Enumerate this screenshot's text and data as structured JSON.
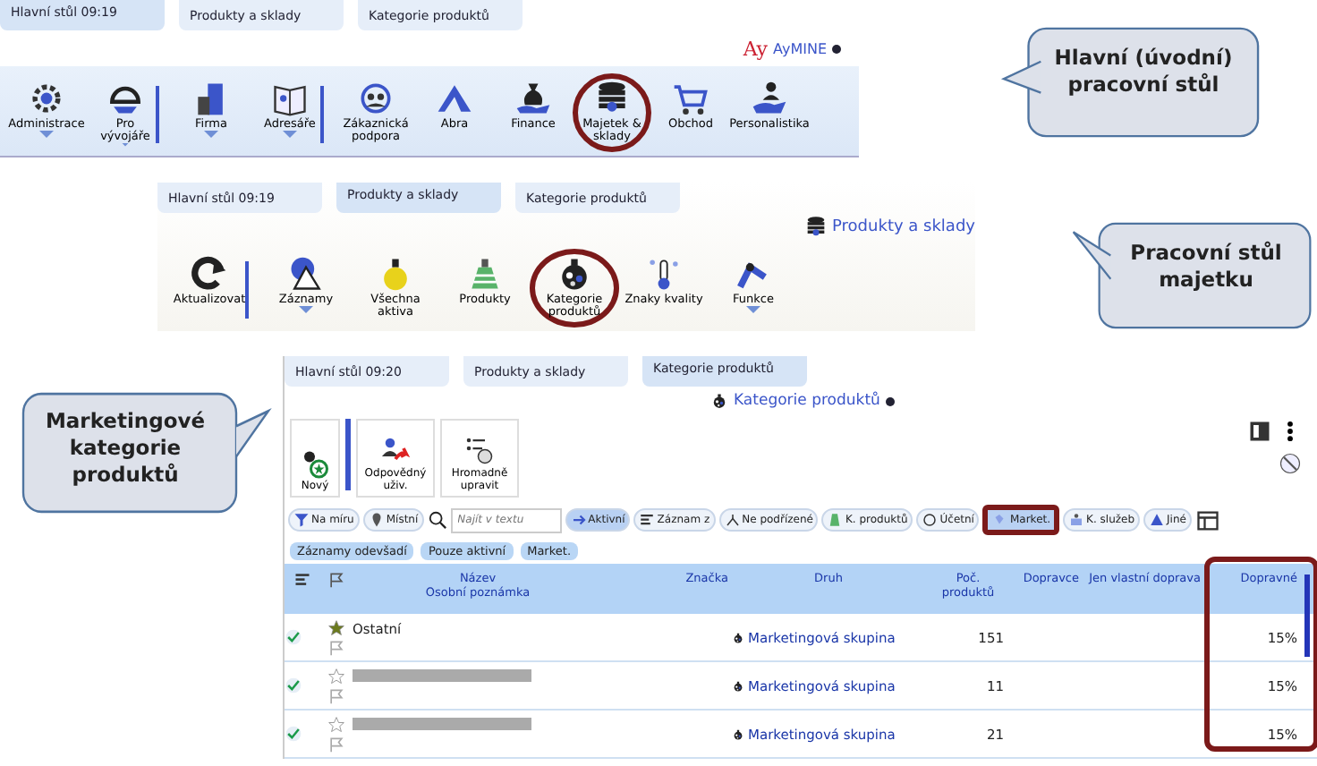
{
  "main_desktop": {
    "tabs": [
      {
        "label": "Hlavní stůl 09:19",
        "selected": true
      },
      {
        "label": "Produkty a sklady",
        "selected": false
      },
      {
        "label": "Kategorie produktů",
        "selected": false
      }
    ],
    "logo": {
      "mark": "Ay",
      "name": "AyMINE"
    },
    "modules": [
      {
        "label": "Administrace",
        "has_menu": true,
        "separator_after": false,
        "highlighted": false
      },
      {
        "label": "Pro vývojáře",
        "has_menu": true,
        "separator_after": true,
        "highlighted": false
      },
      {
        "label": "Firma",
        "has_menu": true,
        "separator_after": false,
        "highlighted": false
      },
      {
        "label": "Adresáře",
        "has_menu": true,
        "separator_after": true,
        "highlighted": false
      },
      {
        "label": "Zákaznická podpora",
        "has_menu": false,
        "separator_after": false,
        "highlighted": false
      },
      {
        "label": "Abra",
        "has_menu": false,
        "separator_after": false,
        "highlighted": false
      },
      {
        "label": "Finance",
        "has_menu": false,
        "separator_after": false,
        "highlighted": false
      },
      {
        "label": "Majetek & sklady",
        "has_menu": false,
        "separator_after": false,
        "highlighted": true
      },
      {
        "label": "Obchod",
        "has_menu": false,
        "separator_after": false,
        "highlighted": false
      },
      {
        "label": "Personalistika",
        "has_menu": false,
        "separator_after": false,
        "highlighted": false
      }
    ]
  },
  "asset_desktop": {
    "tabs": [
      {
        "label": "Hlavní stůl 09:19",
        "selected": false
      },
      {
        "label": "Produkty a sklady",
        "selected": true
      },
      {
        "label": "Kategorie produktů",
        "selected": false
      }
    ],
    "header": "Produkty a sklady",
    "tools": [
      {
        "label": "Aktualizovat",
        "has_menu": false,
        "separator_after": true,
        "highlighted": false
      },
      {
        "label": "Záznamy",
        "has_menu": true,
        "separator_after": false,
        "highlighted": false
      },
      {
        "label": "Všechna aktiva",
        "has_menu": false,
        "separator_after": false,
        "highlighted": false
      },
      {
        "label": "Produkty",
        "has_menu": false,
        "separator_after": false,
        "highlighted": false
      },
      {
        "label": "Kategorie produktů",
        "has_menu": false,
        "separator_after": false,
        "highlighted": true
      },
      {
        "label": "Znaky kvality",
        "has_menu": false,
        "separator_after": false,
        "highlighted": false
      },
      {
        "label": "Funkce",
        "has_menu": true,
        "separator_after": false,
        "highlighted": false
      }
    ]
  },
  "category_view": {
    "tabs": [
      {
        "label": "Hlavní stůl 09:20",
        "selected": false
      },
      {
        "label": "Produkty a sklady",
        "selected": false
      },
      {
        "label": "Kategorie produktů",
        "selected": true
      }
    ],
    "title": "Kategorie produktů",
    "actions": [
      "Nový",
      "Odpovědný uživ.",
      "Hromadně upravit"
    ],
    "filters_left": [
      {
        "label": "Na míru",
        "selected": false
      },
      {
        "label": "Místní",
        "selected": false
      }
    ],
    "search": {
      "placeholder": "Najít v textu"
    },
    "filters_right": [
      {
        "label": "Aktivní",
        "selected": true,
        "highlighted": false
      },
      {
        "label": "Záznam z",
        "selected": false,
        "highlighted": false
      },
      {
        "label": "Ne podřízené",
        "selected": false,
        "highlighted": false
      },
      {
        "label": "K. produktů",
        "selected": false,
        "highlighted": false
      },
      {
        "label": "Účetní",
        "selected": false,
        "highlighted": false
      },
      {
        "label": "Market.",
        "selected": true,
        "highlighted": true
      },
      {
        "label": "K. služeb",
        "selected": false,
        "highlighted": false
      },
      {
        "label": "Jiné",
        "selected": false,
        "highlighted": false
      }
    ],
    "chips": [
      "Záznamy odevšadí",
      "Pouze aktivní",
      "Market."
    ],
    "table": {
      "last_column_highlighted": true,
      "columns": [
        {
          "label": "Název",
          "sublabel": "Osobní poznámka"
        },
        {
          "label": "Značka"
        },
        {
          "label": "Druh"
        },
        {
          "label": "Poč. produktů"
        },
        {
          "label": "Dopravce"
        },
        {
          "label": "Jen vlastní doprava"
        },
        {
          "label": "Dopravné"
        }
      ],
      "rows": [
        {
          "active": true,
          "starred": true,
          "redacted": false,
          "name": "Ostatní",
          "type": "Marketingová skupina",
          "count": "151",
          "fee": "15%"
        },
        {
          "active": true,
          "starred": false,
          "redacted": true,
          "type": "Marketingová skupina",
          "count": "11",
          "fee": "15%"
        },
        {
          "active": true,
          "starred": false,
          "redacted": true,
          "type": "Marketingová skupina",
          "count": "21",
          "fee": "15%"
        }
      ]
    }
  },
  "callouts": [
    {
      "text": "Hlavní (úvodní) pracovní stůl"
    },
    {
      "text": "Pracovní stůl majetku"
    },
    {
      "text": "Marketingové kategorie produktů"
    }
  ]
}
